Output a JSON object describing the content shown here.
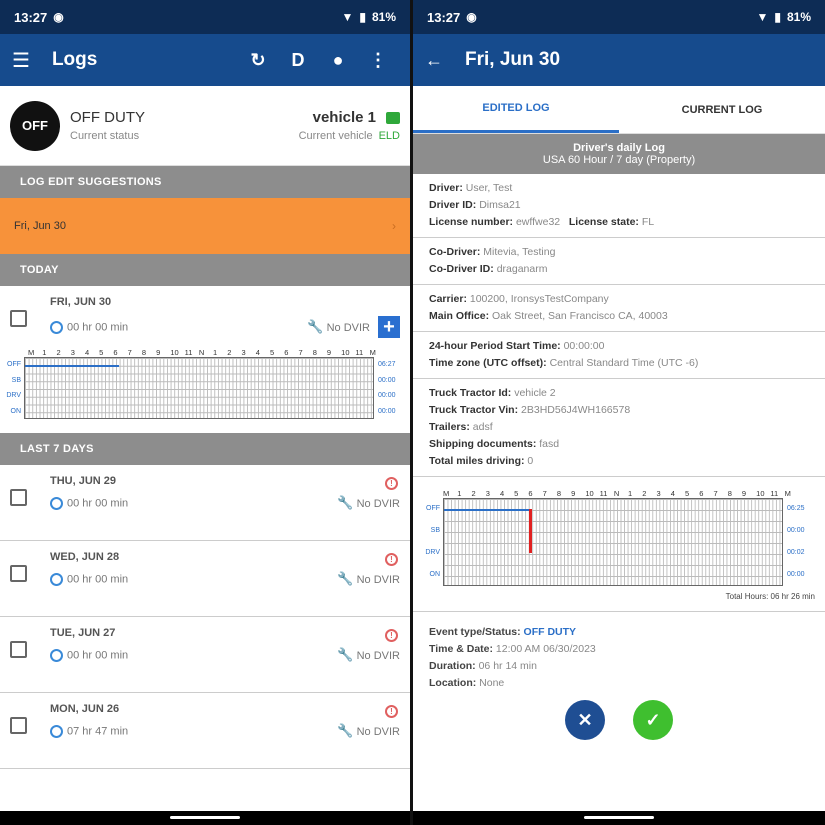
{
  "left": {
    "statusbar": {
      "time": "13:27",
      "battery": "81%"
    },
    "appbar": {
      "title": "Logs",
      "driver_mode": "D"
    },
    "status": {
      "badge": "OFF",
      "main": "OFF DUTY",
      "sub": "Current status",
      "vehicle": "vehicle 1",
      "vehicle_sub": "Current vehicle",
      "eld": "ELD"
    },
    "suggestions": {
      "header": "LOG EDIT SUGGESTIONS",
      "item": "Fri, Jun 30"
    },
    "today": {
      "header": "TODAY",
      "date": "FRI, JUN 30",
      "time": "00 hr  00 min",
      "dvir": "No DVIR",
      "hours": [
        "M",
        "1",
        "2",
        "3",
        "4",
        "5",
        "6",
        "7",
        "8",
        "9",
        "10",
        "11",
        "N",
        "1",
        "2",
        "3",
        "4",
        "5",
        "6",
        "7",
        "8",
        "9",
        "10",
        "11",
        "M"
      ],
      "rows": [
        "OFF",
        "SB",
        "DRV",
        "ON"
      ],
      "totals": [
        "06:27",
        "00:00",
        "00:00",
        "00:00"
      ],
      "off_duty_hours": 6.45
    },
    "last7": {
      "header": "LAST 7 DAYS",
      "items": [
        {
          "date": "THU, JUN 29",
          "time": "00 hr  00 min",
          "dvir": "No DVIR"
        },
        {
          "date": "WED, JUN 28",
          "time": "00 hr  00 min",
          "dvir": "No DVIR"
        },
        {
          "date": "TUE, JUN 27",
          "time": "00 hr  00 min",
          "dvir": "No DVIR"
        },
        {
          "date": "MON, JUN 26",
          "time": "07 hr  47 min",
          "dvir": "No DVIR"
        }
      ]
    }
  },
  "right": {
    "statusbar": {
      "time": "13:27",
      "battery": "81%"
    },
    "appbar": {
      "title": "Fri, Jun 30"
    },
    "tabs": {
      "edited": "EDITED LOG",
      "current": "CURRENT LOG"
    },
    "daily": {
      "title": "Driver's daily Log",
      "sub": "USA 60 Hour / 7 day (Property)"
    },
    "info": {
      "driver_l": "Driver:",
      "driver_v": "User, Test",
      "driverid_l": "Driver ID:",
      "driverid_v": "Dimsa21",
      "lic_l": "License number:",
      "lic_v": "ewffwe32",
      "licstate_l": "License state:",
      "licstate_v": "FL",
      "codriver_l": "Co-Driver:",
      "codriver_v": "Mitevia, Testing",
      "codriverid_l": "Co-Driver ID:",
      "codriverid_v": "draganarm",
      "carrier_l": "Carrier:",
      "carrier_v": "100200, IronsysTestCompany",
      "office_l": "Main Office:",
      "office_v": "Oak Street, San Francisco CA, 40003",
      "period_l": "24-hour Period Start Time:",
      "period_v": "00:00:00",
      "tz_l": "Time zone (UTC offset):",
      "tz_v": "Central Standard Time (UTC -6)",
      "tt_l": "Truck Tractor Id:",
      "tt_v": "vehicle 2",
      "vin_l": "Truck Tractor Vin:",
      "vin_v": "2B3HD56J4WH166578",
      "trailers_l": "Trailers:",
      "trailers_v": "adsf",
      "ship_l": "Shipping documents:",
      "ship_v": "fasd",
      "miles_l": "Total miles driving:",
      "miles_v": "0"
    },
    "grid": {
      "hours": [
        "M",
        "1",
        "2",
        "3",
        "4",
        "5",
        "6",
        "7",
        "8",
        "9",
        "10",
        "11",
        "N",
        "1",
        "2",
        "3",
        "4",
        "5",
        "6",
        "7",
        "8",
        "9",
        "10",
        "11",
        "M"
      ],
      "rows": [
        "OFF",
        "SB",
        "DRV",
        "ON"
      ],
      "totals": [
        "06:25",
        "00:00",
        "00:02",
        "00:00"
      ],
      "total_hours": "Total Hours: 06 hr  26 min",
      "off_duty_hours": 6.0
    },
    "event": {
      "type_l": "Event type/Status:",
      "type_v": "OFF DUTY",
      "time_l": "Time & Date:",
      "time_v": "12:00 AM 06/30/2023",
      "dur_l": "Duration:",
      "dur_v": "06 hr  14 min",
      "loc_l": "Location:",
      "loc_v": "None"
    }
  },
  "colors": {
    "appbar": "#164b8d",
    "statusbar": "#0d2c55",
    "suggest": "#f7923a",
    "section": "#8d8d8d",
    "accent": "#2b6fc7"
  }
}
